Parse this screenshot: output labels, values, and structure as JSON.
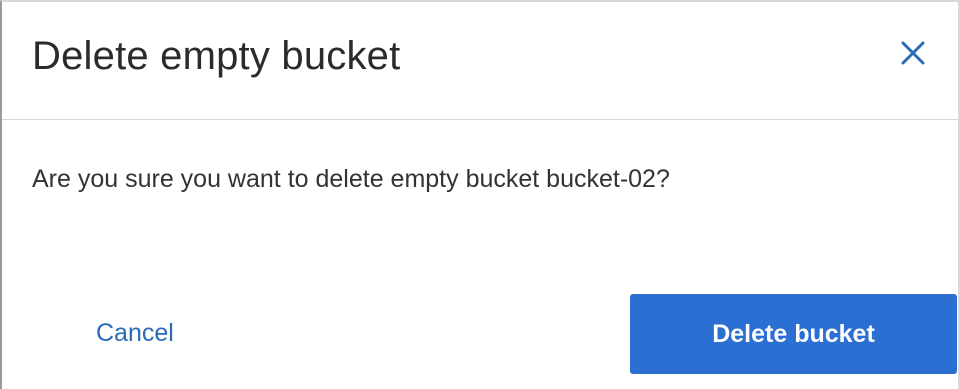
{
  "dialog": {
    "title": "Delete empty bucket",
    "message": "Are you sure you want to delete empty bucket bucket-02?",
    "close_icon": "close-icon",
    "cancel_label": "Cancel",
    "confirm_label": "Delete bucket"
  },
  "colors": {
    "primary_button": "#2b6fd3",
    "link": "#2a6db5",
    "close_icon": "#2a6db5",
    "title_text": "#2b2b2b",
    "divider": "#d6d6d6"
  }
}
